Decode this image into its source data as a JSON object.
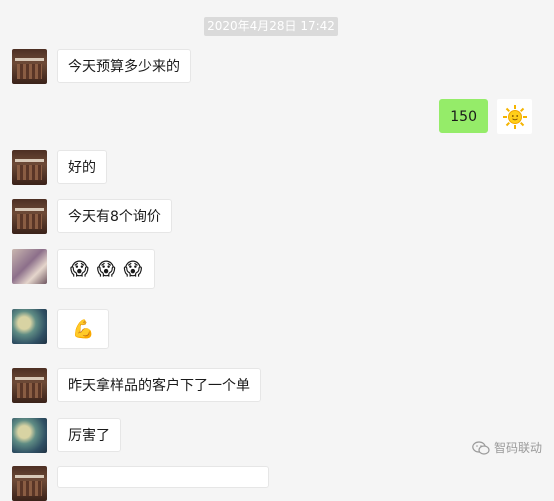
{
  "timestamp": "2020年4月28日 17:42",
  "messages": [
    {
      "side": "left",
      "avatar": "box",
      "text": "今天预算多少来的"
    },
    {
      "side": "right",
      "avatar": "sun",
      "text": "150"
    },
    {
      "side": "left",
      "avatar": "box",
      "text": "好的"
    },
    {
      "side": "left",
      "avatar": "box",
      "text": "今天有8个询价"
    },
    {
      "side": "left",
      "avatar": "room",
      "text": "😱😱😱"
    },
    {
      "side": "left",
      "avatar": "sea",
      "text": "💪"
    },
    {
      "side": "left",
      "avatar": "box",
      "text": "昨天拿样品的客户下了一个单"
    },
    {
      "side": "left",
      "avatar": "sea",
      "text": "厉害了"
    }
  ],
  "watermark": "智码联动",
  "colors": {
    "sent_bubble": "#95ec69",
    "received_bubble": "#ffffff",
    "background": "#f5f5f5"
  }
}
